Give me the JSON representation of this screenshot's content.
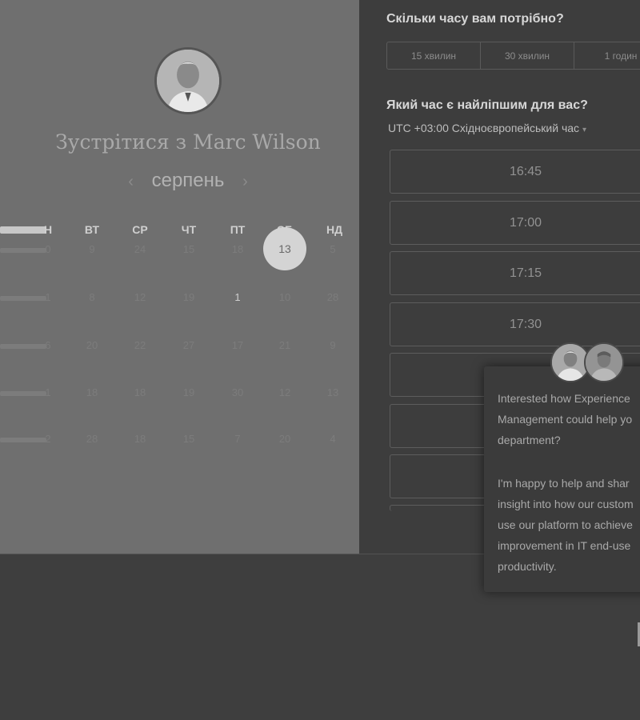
{
  "calendar": {
    "title": "Зустрітися з Marc Wilson",
    "month": "серпень",
    "prev_icon": "‹",
    "next_icon": "›",
    "weekdays": [
      "Н",
      "ВТ",
      "СР",
      "ЧТ",
      "ПТ",
      "СБ",
      "НД"
    ],
    "rows": [
      [
        "0",
        "9",
        "24",
        "15",
        "18",
        "13",
        "5"
      ],
      [
        "1",
        "8",
        "12",
        "19",
        "1",
        "10",
        "28"
      ],
      [
        "6",
        "20",
        "22",
        "27",
        "17",
        "21",
        "9"
      ],
      [
        "1",
        "18",
        "18",
        "19",
        "30",
        "12",
        "13"
      ],
      [
        "2",
        "28",
        "18",
        "15",
        "7",
        "20",
        "4"
      ]
    ],
    "selected_day": "13"
  },
  "scheduler": {
    "duration_question": "Скільки часу вам потрібно?",
    "durations": [
      "15 хвилин",
      "30 хвилин",
      "1 годин"
    ],
    "time_question": "Який час є найліпшим для вас?",
    "timezone": "UTC +03:00 Східноєвропейський час",
    "timezone_caret": "▾",
    "slots": [
      "16:45",
      "17:00",
      "17:15",
      "17:30",
      "",
      "",
      ""
    ]
  },
  "chat": {
    "lines": [
      "Interested how Experience",
      "Management could help yo",
      "department?",
      "I'm happy to help and shar",
      "insight into how our custom",
      "use our platform to achieve",
      "improvement in IT end-use",
      "productivity."
    ]
  },
  "colors": {
    "left_panel": "#6f6f6f",
    "right_panel": "#3d3d3d",
    "selected_day_bg": "#d4d4d4"
  }
}
